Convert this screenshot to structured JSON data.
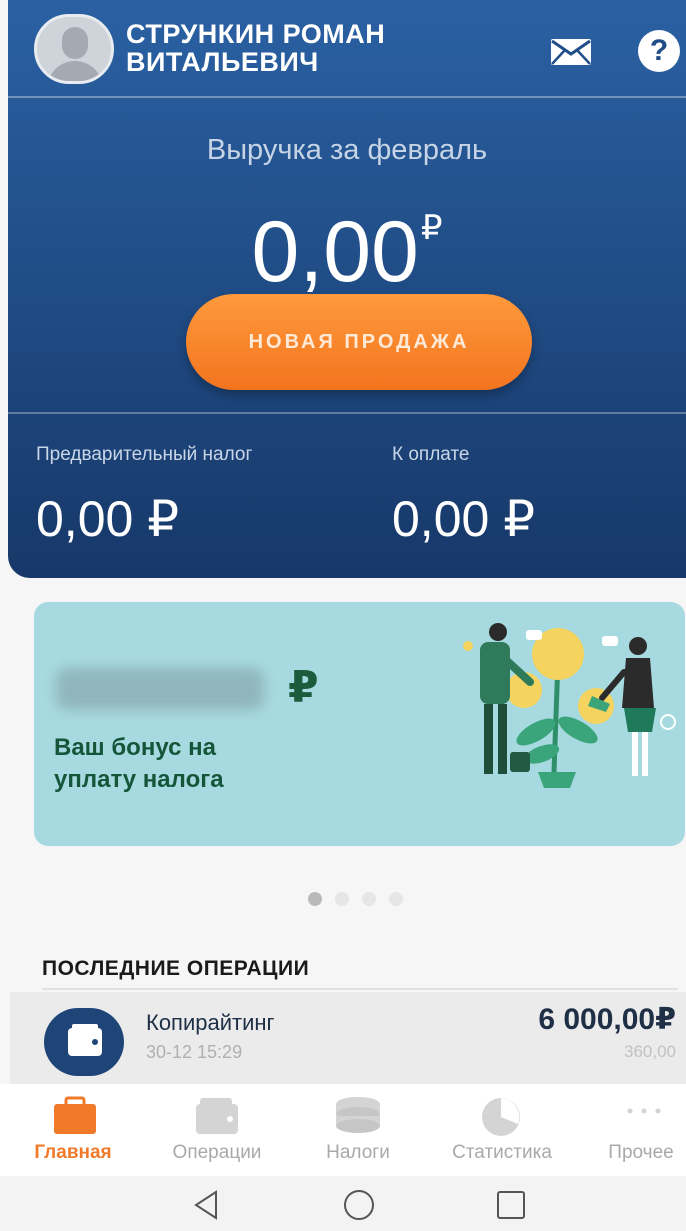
{
  "header": {
    "user_name_line1": "СТРУНКИН РОМАН",
    "user_name_line2": "ВИТАЛЬЕВИЧ",
    "icons": [
      "avatar",
      "mail-icon",
      "help-icon"
    ],
    "help_glyph": "?"
  },
  "revenue": {
    "label": "Выручка за февраль",
    "value": "0,00",
    "currency": "₽"
  },
  "new_sale_button": "НОВАЯ ПРОДАЖА",
  "taxes": {
    "preliminary_label": "Предварительный налог",
    "preliminary_value": "0,00 ₽",
    "to_pay_label": "К оплате",
    "to_pay_value": "0,00 ₽"
  },
  "promo": {
    "currency": "₽",
    "text_line1": "Ваш бонус на",
    "text_line2": "уплату налога",
    "background_color": "#a7dae0",
    "slides_count": 4,
    "active_slide": 1
  },
  "recent_operations": {
    "title": "ПОСЛЕДНИЕ ОПЕРАЦИИ",
    "items": [
      {
        "name": "Копирайтинг",
        "date": "30-12 15:29",
        "amount": "6 000,00₽",
        "tax": "360,00",
        "icon": "wallet-icon"
      }
    ]
  },
  "bottom_nav": {
    "items": [
      {
        "label": "Главная",
        "icon": "briefcase-icon",
        "active": true
      },
      {
        "label": "Операции",
        "icon": "wallet-icon",
        "active": false
      },
      {
        "label": "Налоги",
        "icon": "coins-stack-icon",
        "active": false
      },
      {
        "label": "Статистика",
        "icon": "pie-chart-icon",
        "active": false
      },
      {
        "label": "Прочее",
        "icon": "more-dots-icon",
        "active": false
      }
    ]
  },
  "system_nav": [
    "back-icon",
    "home-icon",
    "recents-icon"
  ],
  "colors": {
    "primary_blue": "#214e88",
    "accent_orange": "#f0792a",
    "promo_green": "#15563a"
  }
}
